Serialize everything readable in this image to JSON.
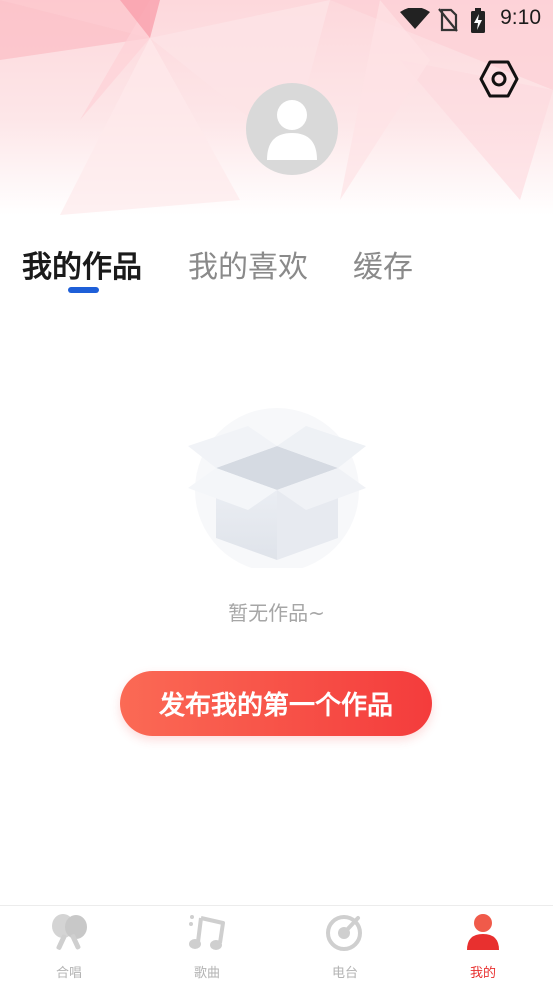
{
  "status_bar": {
    "time": "9:10",
    "icons": [
      "wifi-icon",
      "no-sim-icon",
      "battery-charging-icon"
    ]
  },
  "header": {
    "settings_icon": "settings-hexagon-icon",
    "avatar_icon": "default-user-avatar-icon"
  },
  "tabs": [
    {
      "label": "我的作品",
      "active": true
    },
    {
      "label": "我的喜欢",
      "active": false
    },
    {
      "label": "缓存",
      "active": false
    }
  ],
  "empty_state": {
    "icon": "empty-box-icon",
    "message": "暂无作品~",
    "action_label": "发布我的第一个作品"
  },
  "bottom_nav": [
    {
      "label": "合唱",
      "icon": "chorus-icon",
      "active": false
    },
    {
      "label": "歌曲",
      "icon": "music-note-icon",
      "active": false
    },
    {
      "label": "电台",
      "icon": "radio-disc-icon",
      "active": false
    },
    {
      "label": "我的",
      "icon": "user-icon",
      "active": true
    }
  ],
  "colors": {
    "accent": "#e8302f",
    "tab_indicator": "#1e5fd8",
    "button_gradient_start": "#fb6a55",
    "button_gradient_end": "#f43c3c"
  }
}
